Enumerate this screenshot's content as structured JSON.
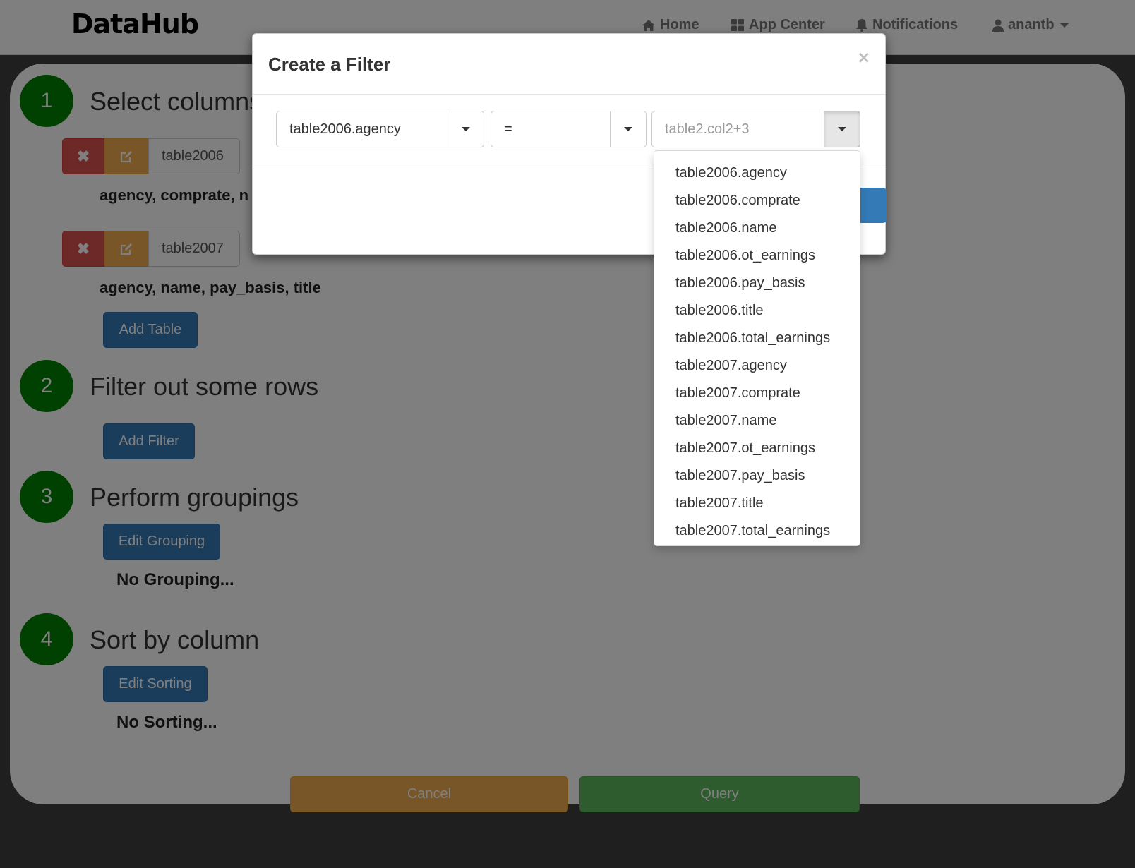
{
  "navbar": {
    "brand": "DataHub",
    "links": {
      "home": "Home",
      "app_center": "App Center",
      "notifications": "Notifications",
      "user": "anantb"
    }
  },
  "steps": [
    {
      "number": "1",
      "title": "Select columns"
    },
    {
      "number": "2",
      "title": "Filter out some rows"
    },
    {
      "number": "3",
      "title": "Perform groupings"
    },
    {
      "number": "4",
      "title": "Sort by column"
    }
  ],
  "tables": [
    {
      "name": "table2006",
      "columns": "agency, comprate, n"
    },
    {
      "name": "table2007",
      "columns": "agency, name, pay_basis, title"
    }
  ],
  "buttons": {
    "add_table": "Add Table",
    "add_filter": "Add Filter",
    "edit_grouping": "Edit Grouping",
    "edit_sorting": "Edit Sorting",
    "cancel": "Cancel",
    "query": "Query"
  },
  "status": {
    "grouping": "No Grouping...",
    "sorting": "No Sorting..."
  },
  "modal": {
    "title": "Create a Filter",
    "close_glyph": "×",
    "left_value": "table2006.agency",
    "operator_value": "=",
    "right_placeholder": "table2.col2+3",
    "dropdown_options": [
      "table2006.agency",
      "table2006.comprate",
      "table2006.name",
      "table2006.ot_earnings",
      "table2006.pay_basis",
      "table2006.title",
      "table2006.total_earnings",
      "table2007.agency",
      "table2007.comprate",
      "table2007.name",
      "table2007.ot_earnings",
      "table2007.pay_basis",
      "table2007.title",
      "table2007.total_earnings"
    ]
  },
  "colors": {
    "step_circle": "#008000",
    "primary": "#337ab7",
    "danger": "#d9534f",
    "warning": "#f0ad4e",
    "success": "#5cb85c"
  },
  "icons": {
    "home": "home-icon",
    "app_center": "th-large-icon",
    "notifications": "bell-icon",
    "user": "user-icon",
    "delete": "close-icon",
    "edit": "edit-icon"
  }
}
